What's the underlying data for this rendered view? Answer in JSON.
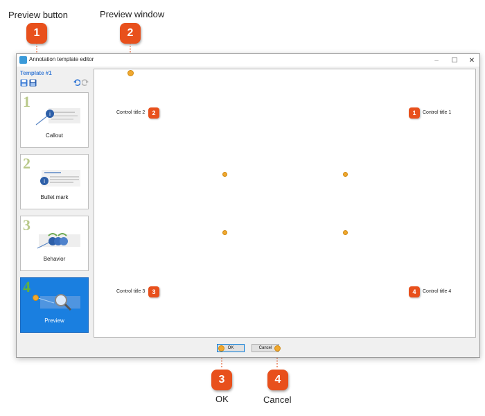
{
  "callouts": {
    "preview_button": {
      "label": "Preview button",
      "num": "1"
    },
    "preview_window": {
      "label": "Preview window",
      "num": "2"
    },
    "ok": {
      "label": "OK",
      "num": "3"
    },
    "cancel": {
      "label": "Cancel",
      "num": "4"
    }
  },
  "window": {
    "title": "Annotation template editor",
    "minimize": "–",
    "maximize": "☐",
    "close": "✕"
  },
  "sidebar": {
    "template_title": "Template #1",
    "cards": [
      {
        "num": "1",
        "label": "Callout"
      },
      {
        "num": "2",
        "label": "Bullet mark"
      },
      {
        "num": "3",
        "label": "Behavior"
      },
      {
        "num": "4",
        "label": "Preview"
      }
    ]
  },
  "preview": {
    "controls": [
      {
        "num": "1",
        "label": "Control title 1"
      },
      {
        "num": "2",
        "label": "Control title 2"
      },
      {
        "num": "3",
        "label": "Control title 3"
      },
      {
        "num": "4",
        "label": "Control title 4"
      }
    ]
  },
  "buttons": {
    "ok": "OK",
    "cancel": "Cancel"
  },
  "colors": {
    "accent": "#e8501c",
    "selected": "#1a7fe0",
    "leader": "#f0a830"
  }
}
